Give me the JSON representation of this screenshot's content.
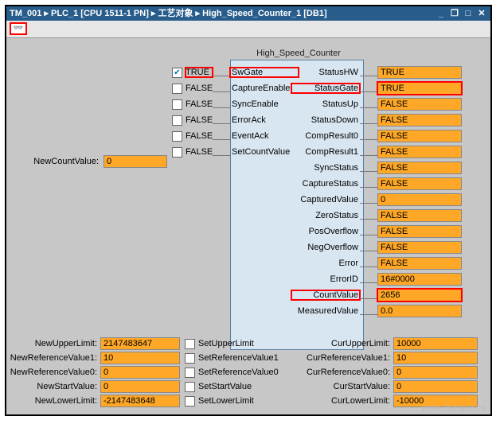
{
  "title": "TM_001 ▸ PLC_1 [CPU 1511-1 PN] ▸ 工艺对象 ▸ High_Speed_Counter_1 [DB1]",
  "fb_name": "High_Speed_Counter",
  "left_inputs": [
    {
      "checked": true,
      "val": "TRUE",
      "port": "SwGate",
      "hl_val": true,
      "hl_port": true
    },
    {
      "checked": false,
      "val": "FALSE",
      "port": "CaptureEnable"
    },
    {
      "checked": false,
      "val": "FALSE",
      "port": "SyncEnable"
    },
    {
      "checked": false,
      "val": "FALSE",
      "port": "ErrorAck"
    },
    {
      "checked": false,
      "val": "FALSE",
      "port": "EventAck"
    },
    {
      "checked": false,
      "val": "FALSE",
      "port": "SetCountValue"
    }
  ],
  "new_count": {
    "label": "NewCountValue:",
    "value": "0"
  },
  "right_outputs": [
    {
      "port": "StatusHW",
      "val": "TRUE"
    },
    {
      "port": "StatusGate",
      "val": "TRUE",
      "hl_port": true,
      "hl_val": true
    },
    {
      "port": "StatusUp",
      "val": "FALSE"
    },
    {
      "port": "StatusDown",
      "val": "FALSE"
    },
    {
      "port": "CompResult0",
      "val": "FALSE"
    },
    {
      "port": "CompResult1",
      "val": "FALSE"
    },
    {
      "port": "SyncStatus",
      "val": "FALSE"
    },
    {
      "port": "CaptureStatus",
      "val": "FALSE"
    },
    {
      "port": "CapturedValue",
      "val": "0"
    },
    {
      "port": "ZeroStatus",
      "val": "FALSE"
    },
    {
      "port": "PosOverflow",
      "val": "FALSE"
    },
    {
      "port": "NegOverflow",
      "val": "FALSE"
    },
    {
      "port": "Error",
      "val": "FALSE"
    },
    {
      "port": "ErrorID",
      "val": "16#0000"
    },
    {
      "port": "CountValue",
      "val": "2656",
      "hl_port": true,
      "hl_val": true
    },
    {
      "port": "MeasuredValue",
      "val": "0.0"
    }
  ],
  "bottom_left": [
    {
      "label": "NewUpperLimit:",
      "val": "2147483647",
      "chk_label": "SetUpperLimit"
    },
    {
      "label": "NewReferenceValue1:",
      "val": "10",
      "chk_label": "SetReferenceValue1"
    },
    {
      "label": "NewReferenceValue0:",
      "val": "0",
      "chk_label": "SetReferenceValue0"
    },
    {
      "label": "NewStartValue:",
      "val": "0",
      "chk_label": "SetStartValue"
    },
    {
      "label": "NewLowerLimit:",
      "val": "-2147483648",
      "chk_label": "SetLowerLimit"
    }
  ],
  "bottom_right": [
    {
      "label": "CurUpperLimit:",
      "val": "10000"
    },
    {
      "label": "CurReferenceValue1:",
      "val": "10"
    },
    {
      "label": "CurReferenceValue0:",
      "val": "0"
    },
    {
      "label": "CurStartValue:",
      "val": "0"
    },
    {
      "label": "CurLowerLimit:",
      "val": "-10000"
    }
  ],
  "watermark": "www.diangon.co"
}
